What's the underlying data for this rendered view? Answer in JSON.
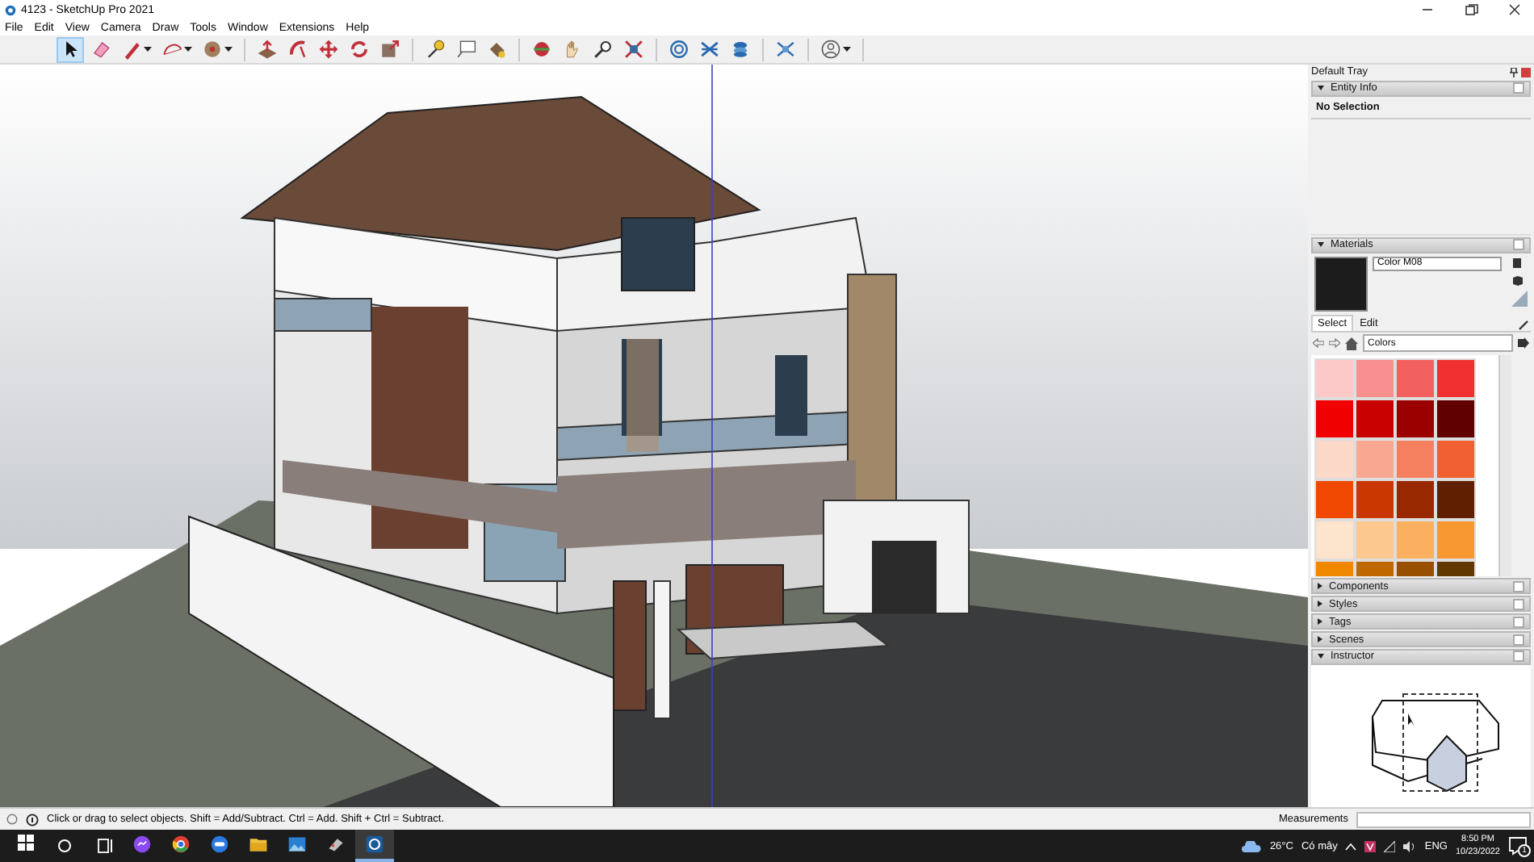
{
  "window": {
    "title": "4123 - SketchUp Pro 2021"
  },
  "menu": [
    "File",
    "Edit",
    "View",
    "Camera",
    "Draw",
    "Tools",
    "Window",
    "Extensions",
    "Help"
  ],
  "toolbar": {
    "groups": [
      [
        {
          "kind": "select",
          "selected": true,
          "dropdown": false
        },
        {
          "kind": "eraser",
          "selected": false,
          "dropdown": false
        },
        {
          "kind": "line",
          "selected": false,
          "dropdown": true
        },
        {
          "kind": "arc",
          "selected": false,
          "dropdown": true
        },
        {
          "kind": "shape",
          "selected": false,
          "dropdown": true
        }
      ],
      [
        {
          "kind": "pushpull",
          "selected": false,
          "dropdown": false
        },
        {
          "kind": "followme",
          "selected": false,
          "dropdown": false
        },
        {
          "kind": "move",
          "selected": false,
          "dropdown": false
        },
        {
          "kind": "rotate",
          "selected": false,
          "dropdown": false
        },
        {
          "kind": "scale",
          "selected": false,
          "dropdown": false
        }
      ],
      [
        {
          "kind": "tape",
          "selected": false,
          "dropdown": false
        },
        {
          "kind": "text",
          "selected": false,
          "dropdown": false
        },
        {
          "kind": "paint",
          "selected": false,
          "dropdown": false
        }
      ],
      [
        {
          "kind": "orbit",
          "selected": false,
          "dropdown": false
        },
        {
          "kind": "pan",
          "selected": false,
          "dropdown": false
        },
        {
          "kind": "zoom",
          "selected": false,
          "dropdown": false
        },
        {
          "kind": "zoomext",
          "selected": false,
          "dropdown": false
        }
      ],
      [
        {
          "kind": "warehouse",
          "selected": false,
          "dropdown": false
        },
        {
          "kind": "extension",
          "selected": false,
          "dropdown": false
        },
        {
          "kind": "layers",
          "selected": false,
          "dropdown": false
        }
      ],
      [
        {
          "kind": "network",
          "selected": false,
          "dropdown": false
        }
      ],
      [
        {
          "kind": "account",
          "selected": false,
          "dropdown": true
        }
      ]
    ]
  },
  "tray": {
    "title": "Default Tray",
    "entity_info": {
      "title": "Entity Info",
      "expanded": true,
      "text": "No Selection"
    },
    "materials": {
      "title": "Materials",
      "expanded": true,
      "name": "Color M08",
      "tabs": [
        {
          "label": "Select",
          "selected": true
        },
        {
          "label": "Edit",
          "selected": false
        }
      ],
      "library": "Colors",
      "swatches": [
        {
          "color": "#fcc8c8"
        },
        {
          "color": "#f89090"
        },
        {
          "color": "#f36060"
        },
        {
          "color": "#f03030"
        },
        {
          "color": "#f00000"
        },
        {
          "color": "#c80000"
        },
        {
          "color": "#9a0000"
        },
        {
          "color": "#600000"
        },
        {
          "color": "#fcd8c8"
        },
        {
          "color": "#f8a890"
        },
        {
          "color": "#f58060"
        },
        {
          "color": "#f06030"
        },
        {
          "color": "#f04800"
        },
        {
          "color": "#c83800"
        },
        {
          "color": "#982800"
        },
        {
          "color": "#602000"
        },
        {
          "color": "#fde4cc"
        },
        {
          "color": "#fcc890"
        },
        {
          "color": "#fbb060"
        },
        {
          "color": "#f89830"
        },
        {
          "color": "#f08800"
        },
        {
          "color": "#c06800"
        },
        {
          "color": "#985000"
        },
        {
          "color": "#603800"
        }
      ]
    },
    "panels": [
      {
        "title": "Components",
        "expanded": false
      },
      {
        "title": "Styles",
        "expanded": false
      },
      {
        "title": "Tags",
        "expanded": false
      },
      {
        "title": "Scenes",
        "expanded": false
      },
      {
        "title": "Instructor",
        "expanded": true
      }
    ]
  },
  "status_bar": {
    "text": "Click or drag to select objects. Shift = Add/Subtract. Ctrl = Add. Shift + Ctrl = Subtract.",
    "measurements_label": "Measurements"
  },
  "taskbar": {
    "apps": [
      {
        "kind": "messenger",
        "active": false
      },
      {
        "kind": "chrome",
        "active": false
      },
      {
        "kind": "zalo",
        "active": false
      },
      {
        "kind": "explorer",
        "active": false
      },
      {
        "kind": "photos",
        "active": false
      },
      {
        "kind": "paint",
        "active": false
      },
      {
        "kind": "sketchup",
        "active": true
      }
    ],
    "weather": {
      "temperature": "26°C",
      "condition": "Có mây"
    },
    "language": "ENG",
    "time": "8:50 PM",
    "date": "10/23/2022",
    "notifications": "1"
  }
}
